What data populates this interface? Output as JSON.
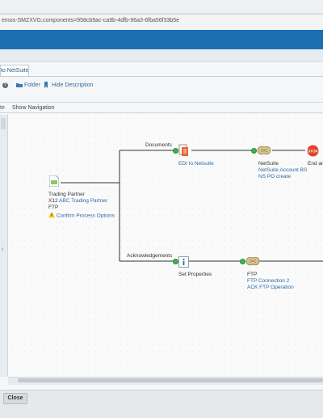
{
  "browser": {
    "url": "emos-SMZXVG;components=958cb9ac-ca9b-4dfb-96a3-6fba56f33b5e"
  },
  "tab": {
    "label": "to NetSuite"
  },
  "toolbar": {
    "folder_label": "Folder",
    "hide_description_label": "Hide Description"
  },
  "subbar": {
    "left_fragment": "te",
    "show_navigation_label": "Show Navigation"
  },
  "process": {
    "start": {
      "title": "Trading Partner",
      "line1_prefix": "X12",
      "line1_link": "ABC Trading Partner",
      "line2": "FTP",
      "option_link": "Confirm Process Options"
    },
    "branches": {
      "documents": "Documents",
      "acknowledgements": "Acknowledgements"
    },
    "map_node": {
      "link": "EDI to Netsuite"
    },
    "netsuite_node": {
      "title": "NetSuite",
      "line1": "NetSuite Account BS",
      "line2": "NS PO create"
    },
    "end_node": {
      "label": "End an",
      "icon_text": "STOP"
    },
    "set_props_node": {
      "title": "Set Properties"
    },
    "ftp_node": {
      "title": "FTP",
      "line1": "FTP Connection 2",
      "line2": "ACK FTP Operation"
    }
  },
  "footer": {
    "close_label": "Close"
  },
  "colors": {
    "header": "#1b6fb0",
    "link": "#2c6aa6",
    "connector_dot": "#3fb34f",
    "stop": "#e0452b"
  }
}
